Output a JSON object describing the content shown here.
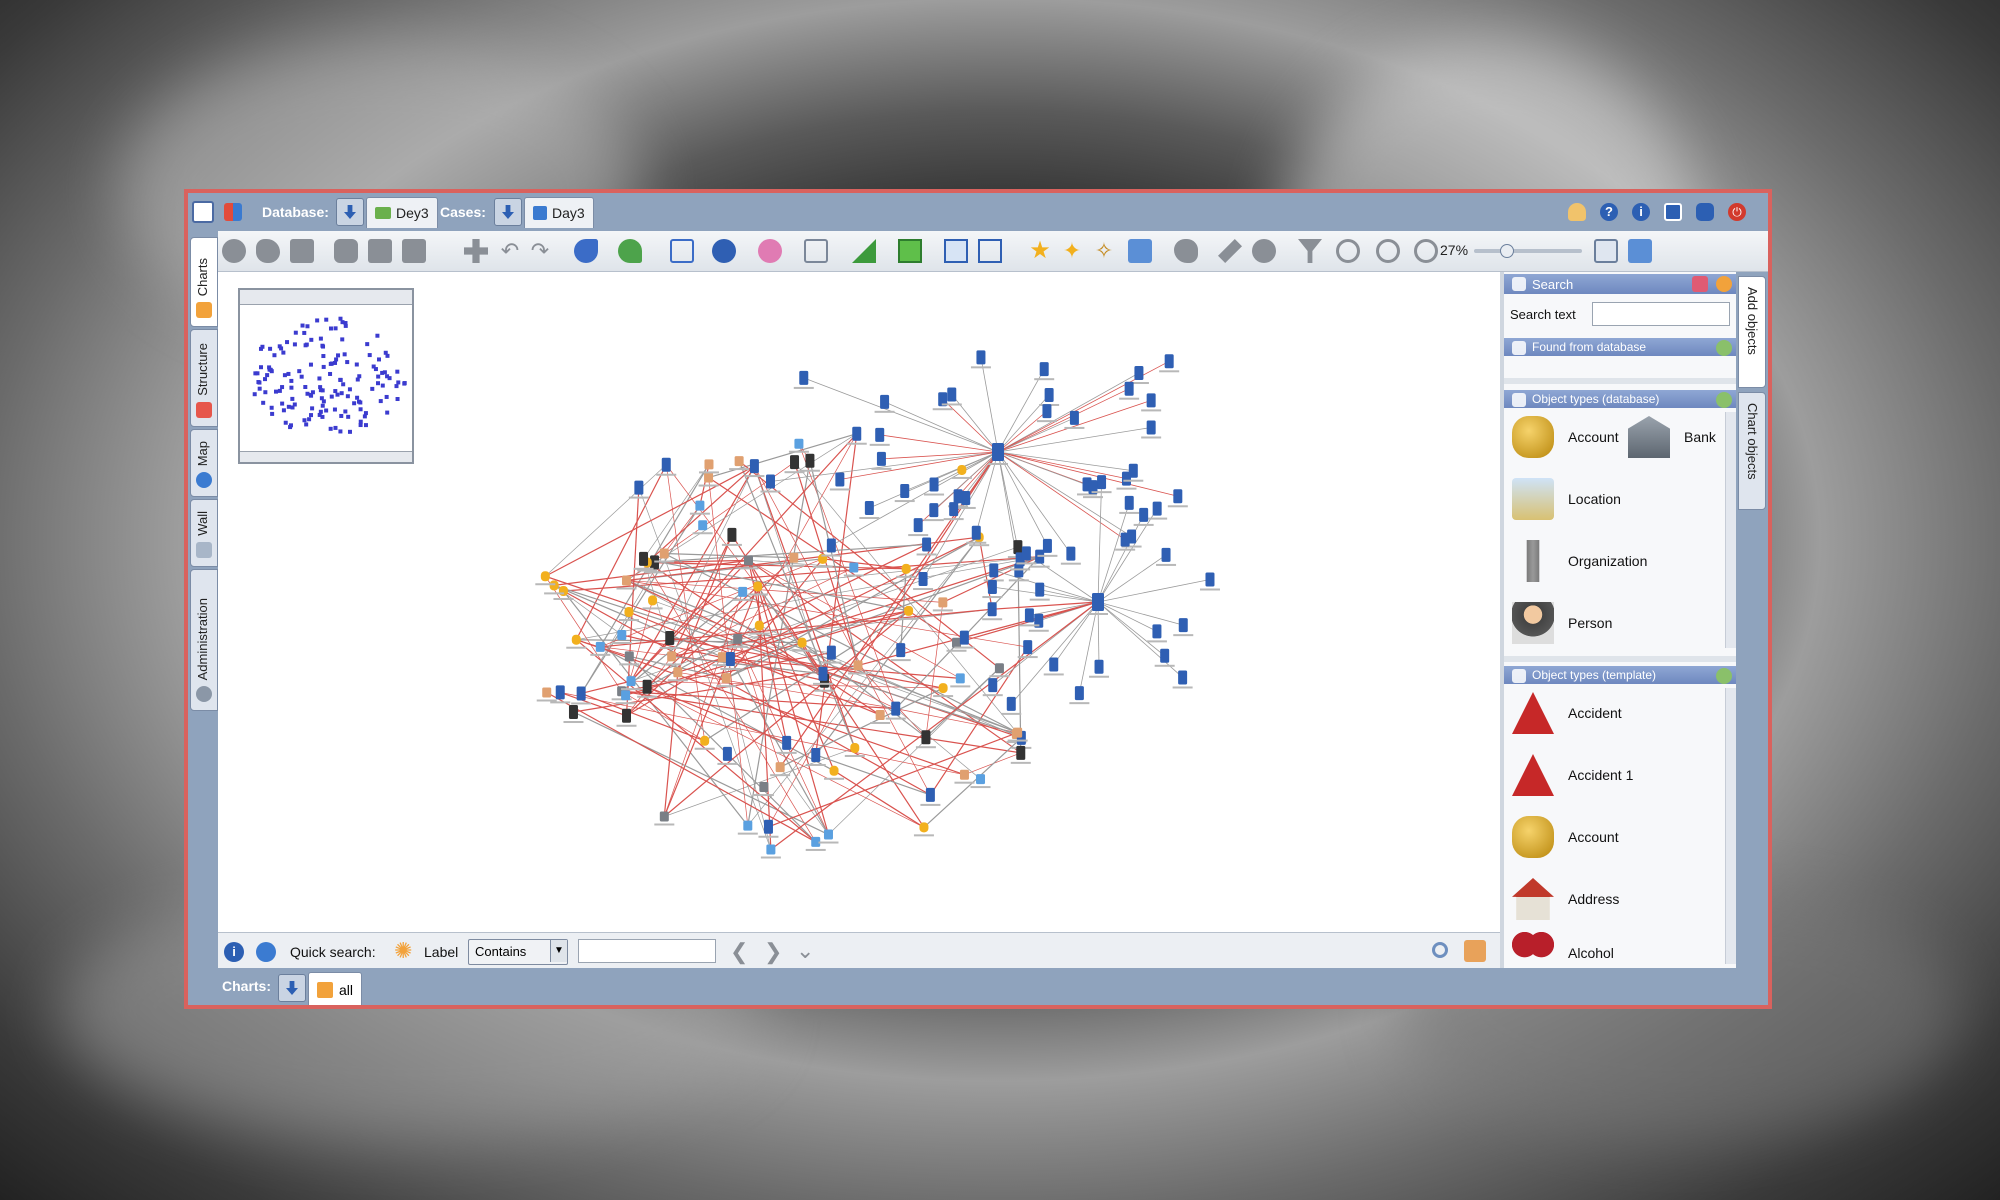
{
  "topbar": {
    "database_label": "Database:",
    "database_tab": "Dey3",
    "cases_label": "Cases:",
    "cases_tab": "Day3"
  },
  "toolbar": {
    "zoom_level": "27%",
    "zoom_fraction": 0.27
  },
  "left_tabs": [
    "Charts",
    "Structure",
    "Map",
    "Wall",
    "Administration"
  ],
  "right_tabs": [
    "Add objects",
    "Chart objects"
  ],
  "search_panel": {
    "title": "Search",
    "search_text_label": "Search text",
    "search_value": "",
    "found_header": "Found from database"
  },
  "object_types_database": {
    "title": "Object types (database)",
    "items": [
      "Account",
      "Bank",
      "Location",
      "Organization",
      "Person"
    ]
  },
  "object_types_template": {
    "title": "Object types (template)",
    "items": [
      "Accident",
      "Accident 1",
      "Account",
      "Address",
      "Alcohol"
    ]
  },
  "quick_search": {
    "label": "Quick search:",
    "field_label": "Label",
    "match_mode": "Contains",
    "value": ""
  },
  "charts_bar": {
    "label": "Charts:",
    "tab": "all"
  },
  "colors": {
    "frame_border": "#d9625e",
    "chrome_blue": "#8fa3bd",
    "link_red": "#d9534f",
    "link_gray": "#9a9a9a",
    "panel_header": "#7a92c8",
    "overview_node": "#3b3bcf"
  },
  "icons": {
    "topbar": [
      "home-icon",
      "windows-icon",
      "database-download-icon",
      "folder-open-icon",
      "case-download-icon",
      "case-icon",
      "user-icon",
      "help-icon",
      "info-icon",
      "window-icon",
      "lock-icon",
      "power-icon"
    ],
    "node_types": [
      "phone-icon",
      "coins-icon",
      "bank-icon",
      "person-icon",
      "tower-icon",
      "location-icon"
    ]
  }
}
